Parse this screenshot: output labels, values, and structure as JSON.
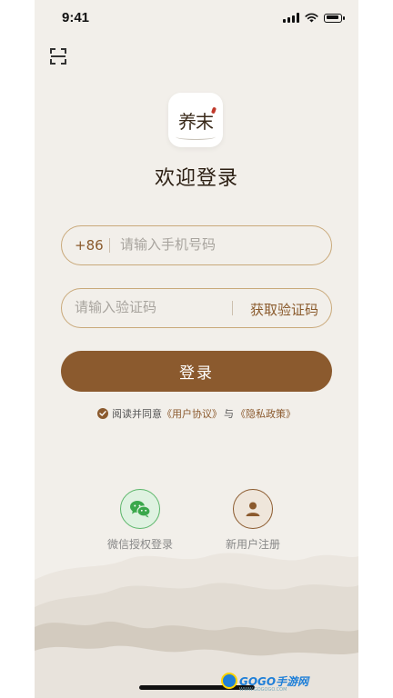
{
  "status_bar": {
    "time": "9:41"
  },
  "app": {
    "logo_text": "养末"
  },
  "page": {
    "title": "欢迎登录"
  },
  "phone_field": {
    "prefix": "+86",
    "placeholder": "请输入手机号码"
  },
  "code_field": {
    "placeholder": "请输入验证码",
    "get_code_label": "获取验证码"
  },
  "login_button": {
    "label": "登录"
  },
  "agreement": {
    "prefix": "阅读并同意",
    "user_agreement": "《用户协议》",
    "conjunction": "与",
    "privacy_policy": "《隐私政策》",
    "checked": true
  },
  "alt_login": {
    "wechat_label": "微信授权登录",
    "register_label": "新用户注册"
  },
  "watermark": {
    "text": "GOGO手游网",
    "sub": "WWW.GOGOGO.COM"
  },
  "colors": {
    "accent": "#8b5a2e",
    "background": "#f2efea",
    "field_border": "#c9a97a",
    "wechat_green": "#5bb66a"
  },
  "icons": {
    "scan": "scan-icon",
    "check": "check-circle-icon",
    "wechat": "wechat-icon",
    "user": "user-icon"
  }
}
